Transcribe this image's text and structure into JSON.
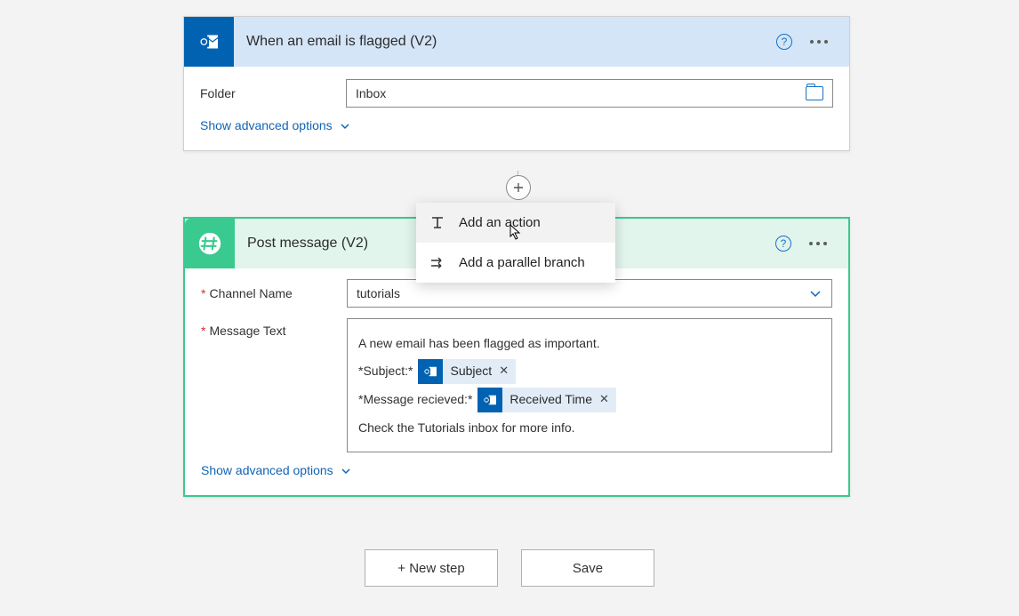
{
  "trigger": {
    "title": "When an email is flagged (V2)",
    "folder_label": "Folder",
    "folder_value": "Inbox",
    "advanced": "Show advanced options"
  },
  "action": {
    "title": "Post message (V2)",
    "channel_label": "Channel Name",
    "channel_value": "tutorials",
    "message_label": "Message Text",
    "msg_line1": "A new email has been flagged as important.",
    "msg_subject_prefix": "*Subject:*",
    "token_subject": "Subject",
    "msg_received_prefix": "*Message recieved:*",
    "token_received": "Received Time",
    "msg_line4": "Check the Tutorials inbox for more info.",
    "advanced": "Show advanced options"
  },
  "popup": {
    "add_action": "Add an action",
    "add_parallel": "Add a parallel branch"
  },
  "buttons": {
    "new_step": "+ New step",
    "save": "Save"
  }
}
